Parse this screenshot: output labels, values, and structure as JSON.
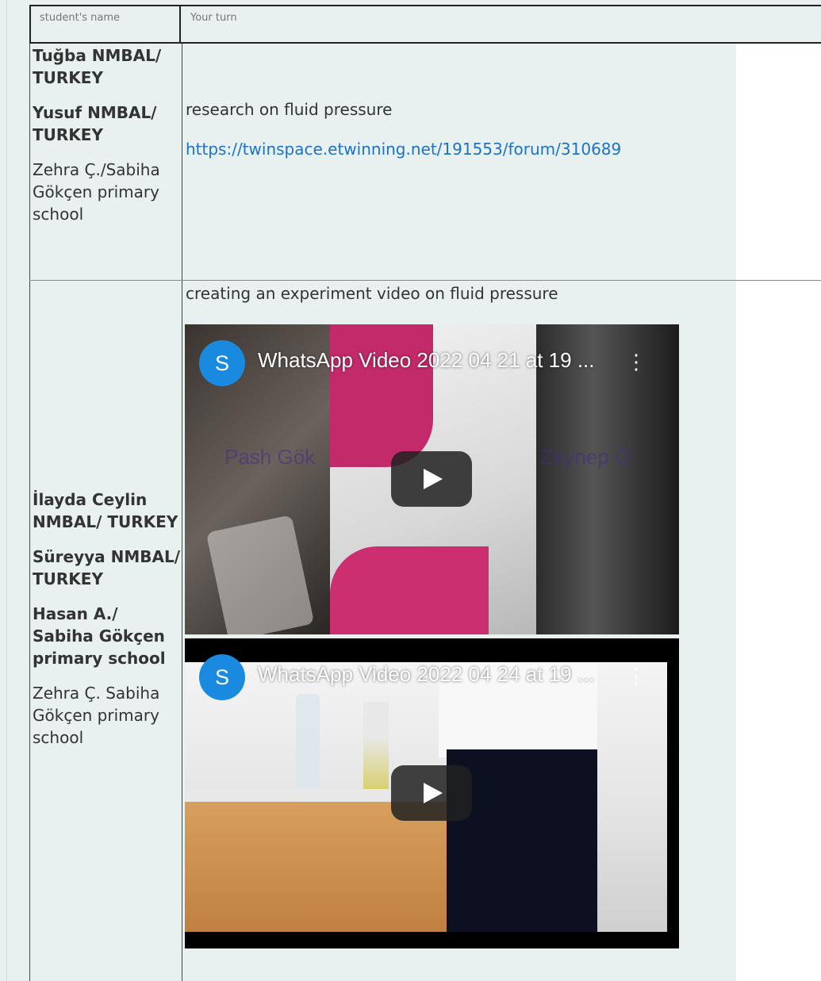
{
  "header": {
    "col_name": "student's name",
    "col_turn": "Your turn"
  },
  "row1": {
    "names": [
      {
        "first": "Tuğba",
        "rest": "NMBAL/ TURKEY",
        "bold": true
      },
      {
        "first": "Yusuf",
        "rest": "NMBAL/ TURKEY",
        "bold": true
      },
      {
        "first": "Zehra Ç./Sabiha Gökçen primary school",
        "rest": "",
        "bold": false
      }
    ],
    "task": "research on fluid pressure",
    "link": "https://twinspace.etwinning.net/191553/forum/310689"
  },
  "row2": {
    "names": [
      {
        "first": "İlayda Ceylin",
        "rest": "NMBAL/ TURKEY",
        "bold": true
      },
      {
        "first": "Süreyya",
        "rest": "NMBAL/ TURKEY",
        "bold": true
      },
      {
        "first": "Hasan A./ Sabiha Gökçen primary school",
        "rest": "",
        "bold": true
      },
      {
        "first": "Zehra Ç. Sabiha Gökçen primary school",
        "rest": "",
        "bold": false
      }
    ],
    "task": "creating an experiment video on fluid pressure",
    "videos": [
      {
        "channel_initial": "S",
        "title": "WhatsApp Video 2022 04 21 at 19 ...",
        "overlay_left": "Pash Gök",
        "overlay_right": "Zeynep Ö"
      },
      {
        "channel_initial": "S",
        "title": "WhatsApp Video 2022 04 24 at 19 ..."
      }
    ]
  },
  "colors": {
    "background": "#e8f0f0",
    "link": "#1a73c8",
    "avatar": "#1a8ae0"
  }
}
